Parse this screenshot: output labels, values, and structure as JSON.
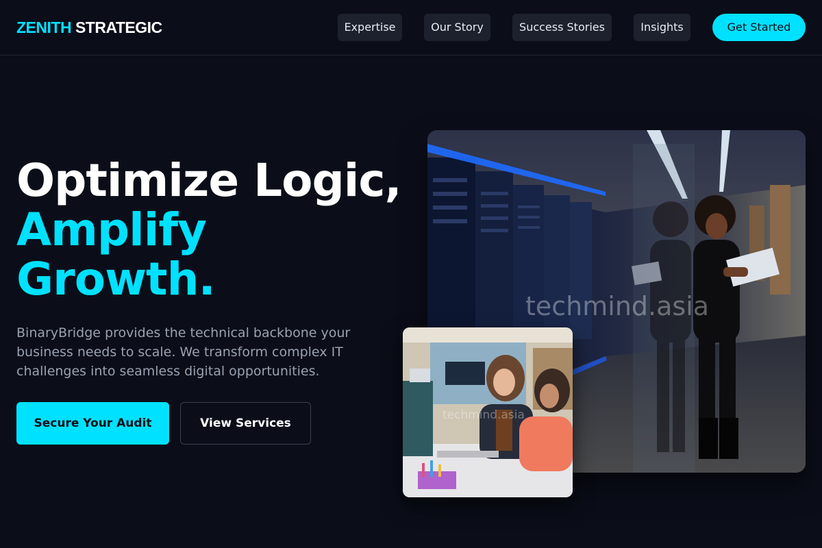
{
  "header": {
    "logo_accent": "ZENITH",
    "logo_rest": "STRATEGIC",
    "nav": [
      {
        "label": "Expertise"
      },
      {
        "label": "Our Story"
      },
      {
        "label": "Success Stories"
      },
      {
        "label": "Insights"
      }
    ],
    "cta_label": "Get Started"
  },
  "hero": {
    "headline_line1": "Optimize Logic,",
    "headline_line2": "Amplify",
    "headline_line3": "Growth.",
    "description": "BinaryBridge provides the technical backbone your business needs to scale. We transform complex IT challenges into seamless digital opportunities.",
    "primary_button": "Secure Your Audit",
    "secondary_button": "View Services"
  },
  "images": {
    "main_watermark": "techmind.asia",
    "secondary_watermark": "techmind.asia"
  },
  "colors": {
    "background": "#0b0e19",
    "accent": "#00e1ff",
    "nav_background": "#1c212d",
    "muted_text": "#9aa1b0"
  }
}
